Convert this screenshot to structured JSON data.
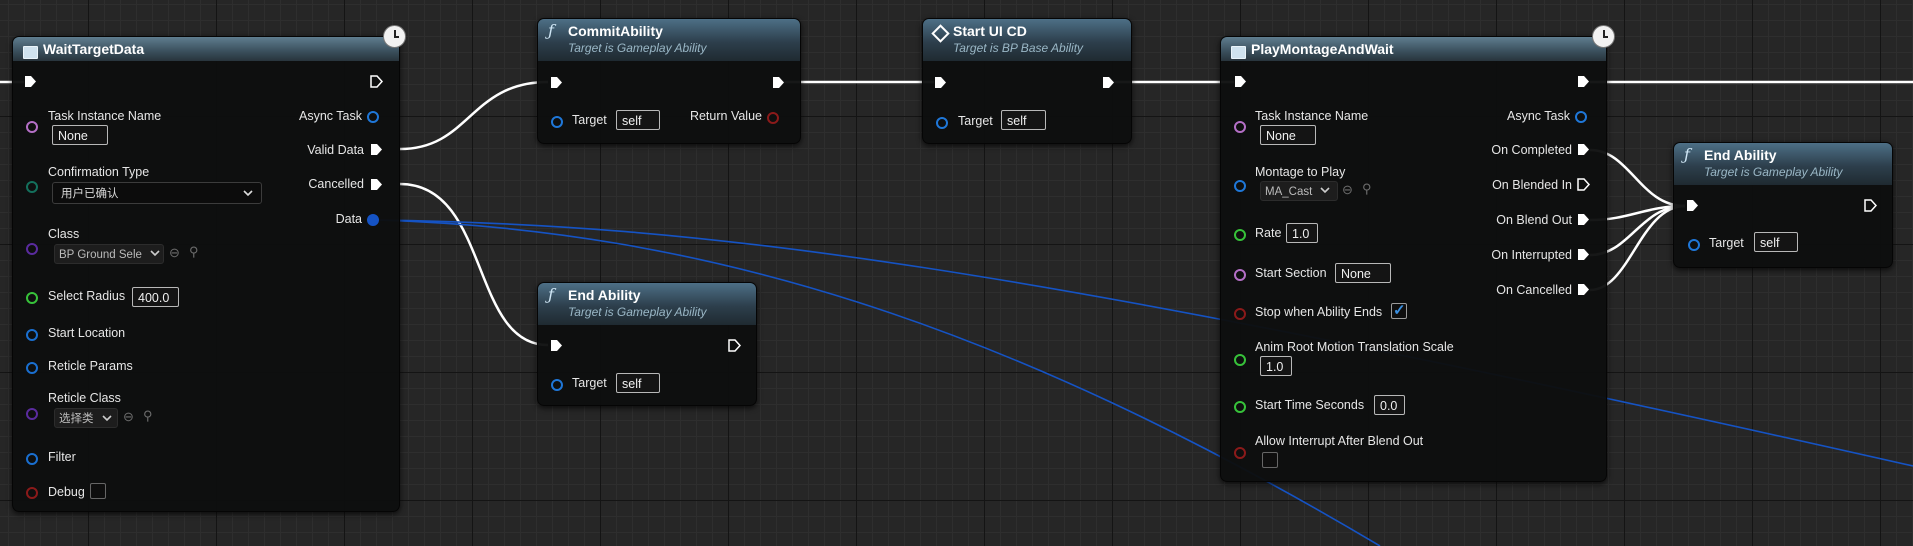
{
  "colors": {
    "exec": "#ffffff",
    "object": "#1f77d8",
    "struct": "#1a6fd0",
    "name": "#b46fc6",
    "float": "#37c23a",
    "bool": "#8b1a1a",
    "enum": "#14705c",
    "class": "#5a2b9e",
    "wire_data": "#1553c4"
  },
  "icons": {
    "function": "function-f-icon",
    "task": "task-square-icon",
    "macro": "macro-diamond-icon",
    "latent": "clock-icon",
    "browse": "browse-arrow-icon",
    "search": "search-icon",
    "dropdown": "chevron-down-icon"
  },
  "wait_target_data": {
    "title": "WaitTargetData",
    "inputs": {
      "task_instance_name": {
        "label": "Task Instance Name",
        "value": "None"
      },
      "confirmation_type": {
        "label": "Confirmation Type",
        "value": "用户已确认"
      },
      "class": {
        "label": "Class",
        "value": "BP Ground Sele"
      },
      "select_radius": {
        "label": "Select Radius",
        "value": "400.0"
      },
      "start_location": {
        "label": "Start Location"
      },
      "reticle_params": {
        "label": "Reticle Params"
      },
      "reticle_class": {
        "label": "Reticle Class",
        "value": "选择类"
      },
      "filter": {
        "label": "Filter"
      },
      "debug": {
        "label": "Debug",
        "checked": false
      }
    },
    "outputs": {
      "async_task": "Async Task",
      "valid_data": "Valid Data",
      "cancelled": "Cancelled",
      "data": "Data"
    }
  },
  "commit_ability": {
    "title": "CommitAbility",
    "subtitle": "Target is Gameplay Ability",
    "target_label": "Target",
    "target_value": "self",
    "return_label": "Return Value"
  },
  "start_ui_cd": {
    "title": "Start UI CD",
    "subtitle": "Target is BP Base Ability",
    "target_label": "Target",
    "target_value": "self"
  },
  "end_ability_1": {
    "title": "End Ability",
    "subtitle": "Target is Gameplay Ability",
    "target_label": "Target",
    "target_value": "self"
  },
  "play_montage": {
    "title": "PlayMontageAndWait",
    "inputs": {
      "task_instance_name": {
        "label": "Task Instance Name",
        "value": "None"
      },
      "montage_to_play": {
        "label": "Montage to Play",
        "value": "MA_Cast"
      },
      "rate": {
        "label": "Rate",
        "value": "1.0"
      },
      "start_section": {
        "label": "Start Section",
        "value": "None"
      },
      "stop_when_ends": {
        "label": "Stop when Ability Ends",
        "checked": true
      },
      "anim_root_motion": {
        "label": "Anim Root Motion Translation Scale",
        "value": "1.0"
      },
      "start_time": {
        "label": "Start Time Seconds",
        "value": "0.0"
      },
      "allow_interrupt": {
        "label": "Allow Interrupt After Blend Out",
        "checked": false
      }
    },
    "outputs": {
      "async_task": "Async Task",
      "on_completed": "On Completed",
      "on_blended_in": "On Blended In",
      "on_blend_out": "On Blend Out",
      "on_interrupted": "On Interrupted",
      "on_cancelled": "On Cancelled"
    }
  },
  "end_ability_2": {
    "title": "End Ability",
    "subtitle": "Target is Gameplay Ability",
    "target_label": "Target",
    "target_value": "self"
  }
}
